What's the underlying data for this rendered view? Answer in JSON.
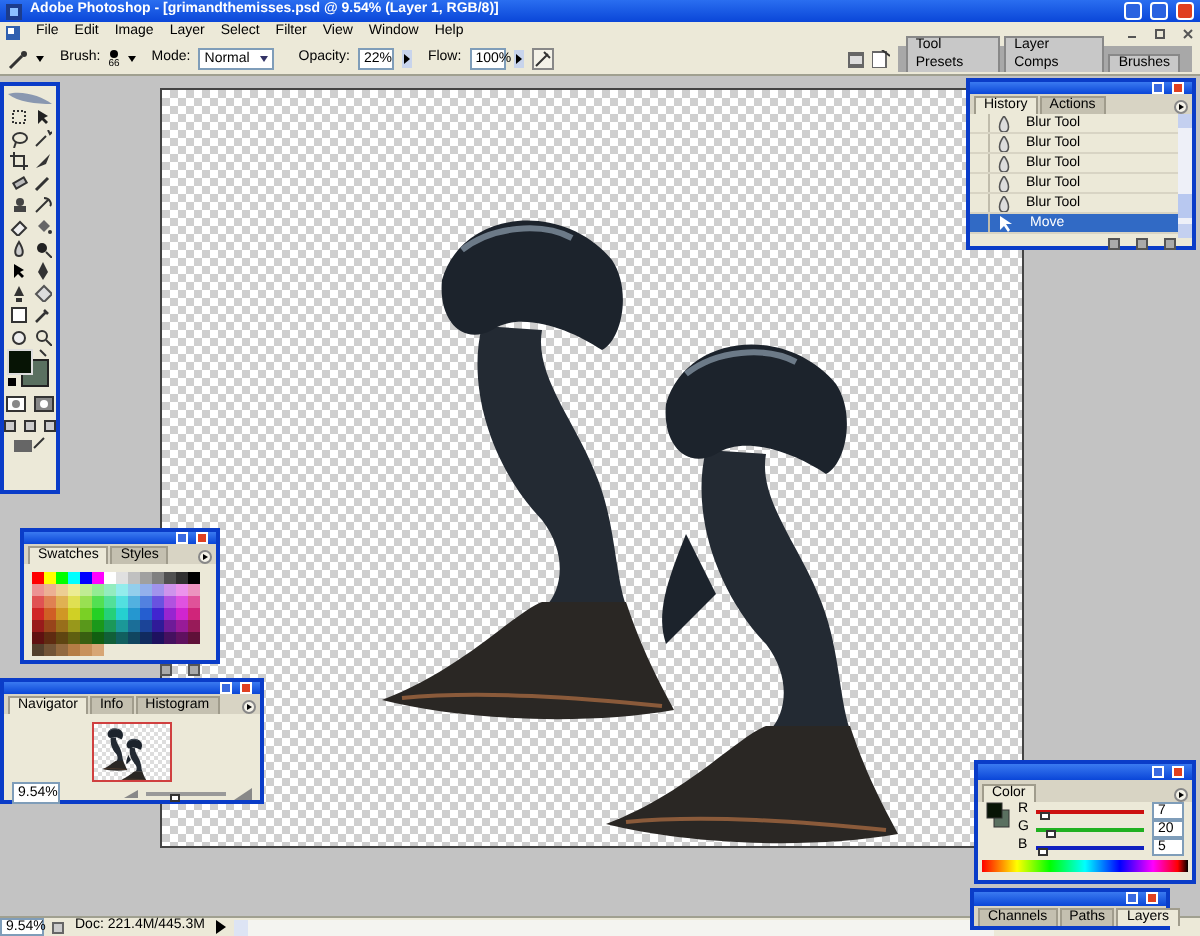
{
  "window": {
    "title": "Adobe Photoshop - [grimandthemisses.psd @ 9.54% (Layer 1, RGB/8)]"
  },
  "menu": [
    "File",
    "Edit",
    "Image",
    "Layer",
    "Select",
    "Filter",
    "View",
    "Window",
    "Help"
  ],
  "options_bar": {
    "brush_label": "Brush:",
    "brush_size": "66",
    "mode_label": "Mode:",
    "mode": "Normal",
    "opacity_label": "Opacity:",
    "opacity": "22%",
    "flow_label": "Flow:",
    "flow": "100%"
  },
  "palette_well": {
    "tabs": [
      "Tool Presets",
      "Layer Comps",
      "Brushes"
    ]
  },
  "history_palette": {
    "tabs": [
      {
        "label": "History",
        "selected": true
      },
      {
        "label": "Actions",
        "selected": false
      }
    ],
    "items": [
      {
        "label": "Blur Tool",
        "kind": "blur",
        "selected": false
      },
      {
        "label": "Blur Tool",
        "kind": "blur",
        "selected": false
      },
      {
        "label": "Blur Tool",
        "kind": "blur",
        "selected": false
      },
      {
        "label": "Blur Tool",
        "kind": "blur",
        "selected": false
      },
      {
        "label": "Blur Tool",
        "kind": "blur",
        "selected": false
      },
      {
        "label": "Move",
        "kind": "move",
        "selected": true
      }
    ]
  },
  "swatches_palette": {
    "tabs": [
      {
        "label": "Swatches",
        "selected": true
      },
      {
        "label": "Styles",
        "selected": false
      }
    ]
  },
  "navigator_palette": {
    "tabs": [
      {
        "label": "Navigator",
        "selected": true
      },
      {
        "label": "Info",
        "selected": false
      },
      {
        "label": "Histogram",
        "selected": false
      }
    ],
    "zoom": "9.54%",
    "zoom_slider": {
      "level": 0.35
    }
  },
  "color_palette": {
    "tabs": [
      {
        "label": "Color",
        "selected": true
      }
    ],
    "channels": [
      {
        "name": "R",
        "value": "7",
        "color": "#cc1010",
        "level": 0.03
      },
      {
        "name": "G",
        "value": "20",
        "color": "#20b020",
        "level": 0.08
      },
      {
        "name": "B",
        "value": "5",
        "color": "#1020c0",
        "level": 0.02
      }
    ]
  },
  "layers_palette": {
    "tabs": [
      {
        "label": "Channels",
        "selected": false
      },
      {
        "label": "Paths",
        "selected": false
      },
      {
        "label": "Layers",
        "selected": true
      }
    ]
  },
  "status_bar": {
    "zoom": "9.54%",
    "doc_info": "Doc: 221.4M/445.3M"
  }
}
